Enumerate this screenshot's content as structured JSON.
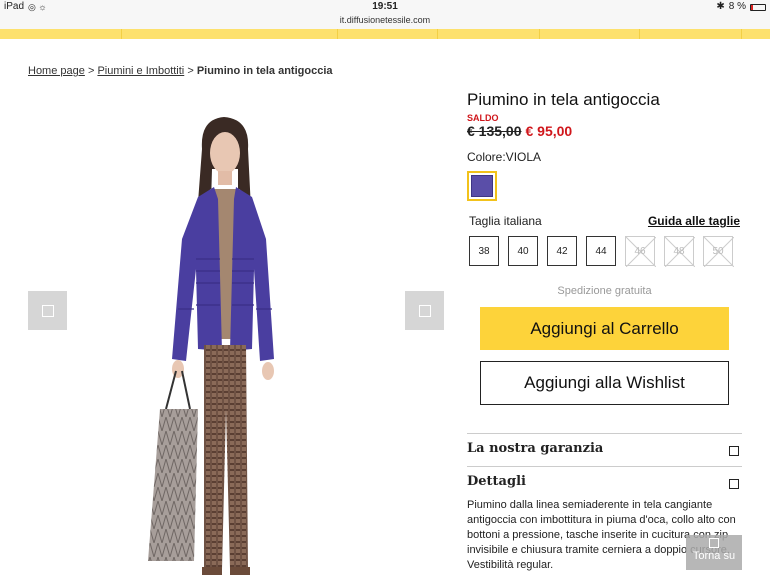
{
  "statusbar": {
    "device": "iPad",
    "time": "19:51",
    "battery": "8 %",
    "url": "it.diffusionetessile.com"
  },
  "breadcrumb": {
    "home": "Home page",
    "category": "Piumini e Imbottiti",
    "current": "Piumino in tela antigoccia",
    "separator": ">"
  },
  "product": {
    "title": "Piumino in tela antigoccia",
    "sale_badge": "SALDO",
    "old_price": "€ 135,00",
    "new_price": "€ 95,00",
    "color_label": "Colore:VIOLA",
    "swatch_color": "#5a4ea8",
    "size_label": "Taglia italiana",
    "size_guide": "Guida alle taglie",
    "sizes": [
      {
        "label": "38",
        "available": true
      },
      {
        "label": "40",
        "available": true
      },
      {
        "label": "42",
        "available": true
      },
      {
        "label": "44",
        "available": true
      },
      {
        "label": "46",
        "available": false
      },
      {
        "label": "48",
        "available": false
      },
      {
        "label": "50",
        "available": false
      }
    ],
    "shipping": "Spedizione gratuita",
    "add_to_cart": "Aggiungi al Carrello",
    "add_to_wishlist": "Aggiungi alla Wishlist"
  },
  "accordion": {
    "guarantee": "La nostra garanzia",
    "details": "Dettagli"
  },
  "description": "Piumino dalla linea semiaderente in tela cangiante antigoccia con imbottitura in piuma d'oca, collo alto con bottoni a pressione, tasche inserite in cucitura con zip invisibile e chiusura tramite cerniera a doppio cursore. Vestibilità regular.",
  "back_to_top": "Torna su",
  "colors": {
    "accent_yellow": "#fdd33a",
    "sale_red": "#d0161b"
  }
}
